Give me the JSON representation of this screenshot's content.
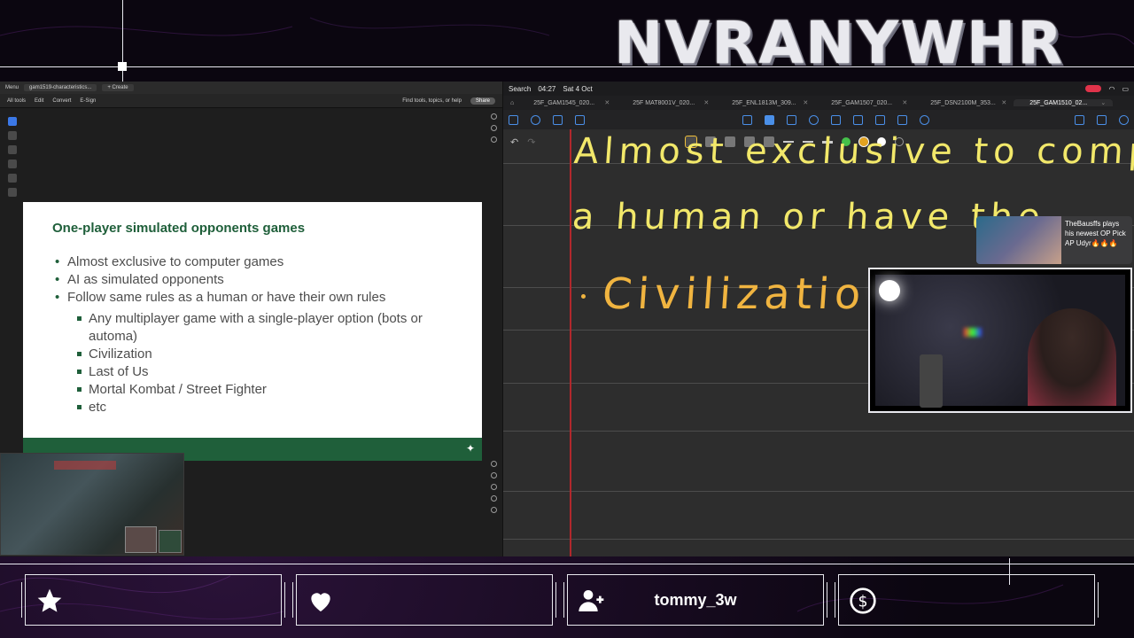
{
  "brand": {
    "text": "NVRANYWHR"
  },
  "pdf_viewer": {
    "menu_label": "Menu",
    "tab_title": "gam1519-characteristics...",
    "create_label": "+ Create",
    "menubar": [
      "All tools",
      "Edit",
      "Convert",
      "E-Sign"
    ],
    "search_placeholder": "Find tools, topics, or help",
    "share_label": "Share"
  },
  "slide": {
    "title": "One-player simulated opponents games",
    "bullets": [
      "Almost exclusive to computer games",
      "AI as simulated opponents",
      "Follow same rules as a human or have their own rules"
    ],
    "sub_bullets": [
      "Any multiplayer game with a single-player option (bots or automa)",
      "Civilization",
      "Last of Us",
      "Mortal Kombat / Street Fighter",
      "etc"
    ]
  },
  "notes_app": {
    "status": {
      "search": "Search",
      "time": "04:27",
      "date": "Sat 4 Oct"
    },
    "tabs": [
      {
        "label": "25F_GAM1545_020...",
        "active": false
      },
      {
        "label": "25F MAT8001V_020...",
        "active": false
      },
      {
        "label": "25F_ENL1813M_309...",
        "active": false
      },
      {
        "label": "25F_GAM1507_020...",
        "active": false
      },
      {
        "label": "25F_DSN2100M_353...",
        "active": false
      },
      {
        "label": "25F_GAM1510_02...",
        "active": true
      }
    ],
    "handwriting": {
      "line1": "Almost exclusive to compute",
      "line2": "a human or have the",
      "line3": "Civilizatio"
    },
    "colors": {
      "yellow_ink": "#f2e86a",
      "orange_ink": "#f0b440",
      "margin_red": "#b1282c"
    }
  },
  "chat_popup": {
    "text": "TheBausffs plays his newest OP Pick AP Udyr🔥🔥🔥",
    "thumb_label": "TheBausffs"
  },
  "alerts": [
    {
      "icon": "star-icon",
      "label": ""
    },
    {
      "icon": "heart-icon",
      "label": ""
    },
    {
      "icon": "follower-icon",
      "label": "tommy_3w"
    },
    {
      "icon": "dollar-icon",
      "label": ""
    }
  ]
}
